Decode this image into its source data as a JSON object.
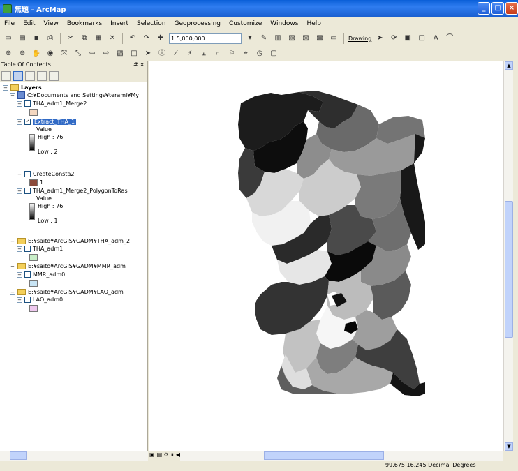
{
  "window": {
    "title": "無題 - ArcMap"
  },
  "menu": [
    "File",
    "Edit",
    "View",
    "Bookmarks",
    "Insert",
    "Selection",
    "Geoprocessing",
    "Customize",
    "Windows",
    "Help"
  ],
  "toolbar": {
    "scale": "1:5,000,000",
    "drawing_label": "Drawing"
  },
  "toc": {
    "title": "Table Of Contents",
    "pin": "# ×",
    "root": "Layers",
    "path1": "C:¥Documents and Settings¥terami¥My",
    "layer_merge2": "THA_adm1_Merge2",
    "layer_extract": "Extract_THA_1",
    "value_label": "Value",
    "high_label": "High : 76",
    "low_label": "Low : 2",
    "layer_const": "CreateConsta2",
    "const_value": "1",
    "layer_poly": "THA_adm1_Merge2_PolygonToRas",
    "value_label2": "Value",
    "high_label2": "High : 76",
    "low_label2": "Low : 1",
    "path2": "E:¥saito¥ArcGIS¥GADM¥THA_adm_2",
    "layer_tha": "THA_adm1",
    "path3": "E:¥saito¥ArcGIS¥GADM¥MMR_adm",
    "layer_mmr": "MMR_adm0",
    "path4": "E:¥saito¥ArcGIS¥GADM¥LAO_adm",
    "layer_lao": "LAO_adm0"
  },
  "colors": {
    "merge2_swatch": "#f4d7c0",
    "const_swatch": "#8b4a3a",
    "tha_swatch": "#c8eec8",
    "mmr_swatch": "#c8e4f4",
    "lao_swatch": "#eec8ee"
  },
  "status": {
    "coords": "99.675  16.245 Decimal Degrees"
  }
}
